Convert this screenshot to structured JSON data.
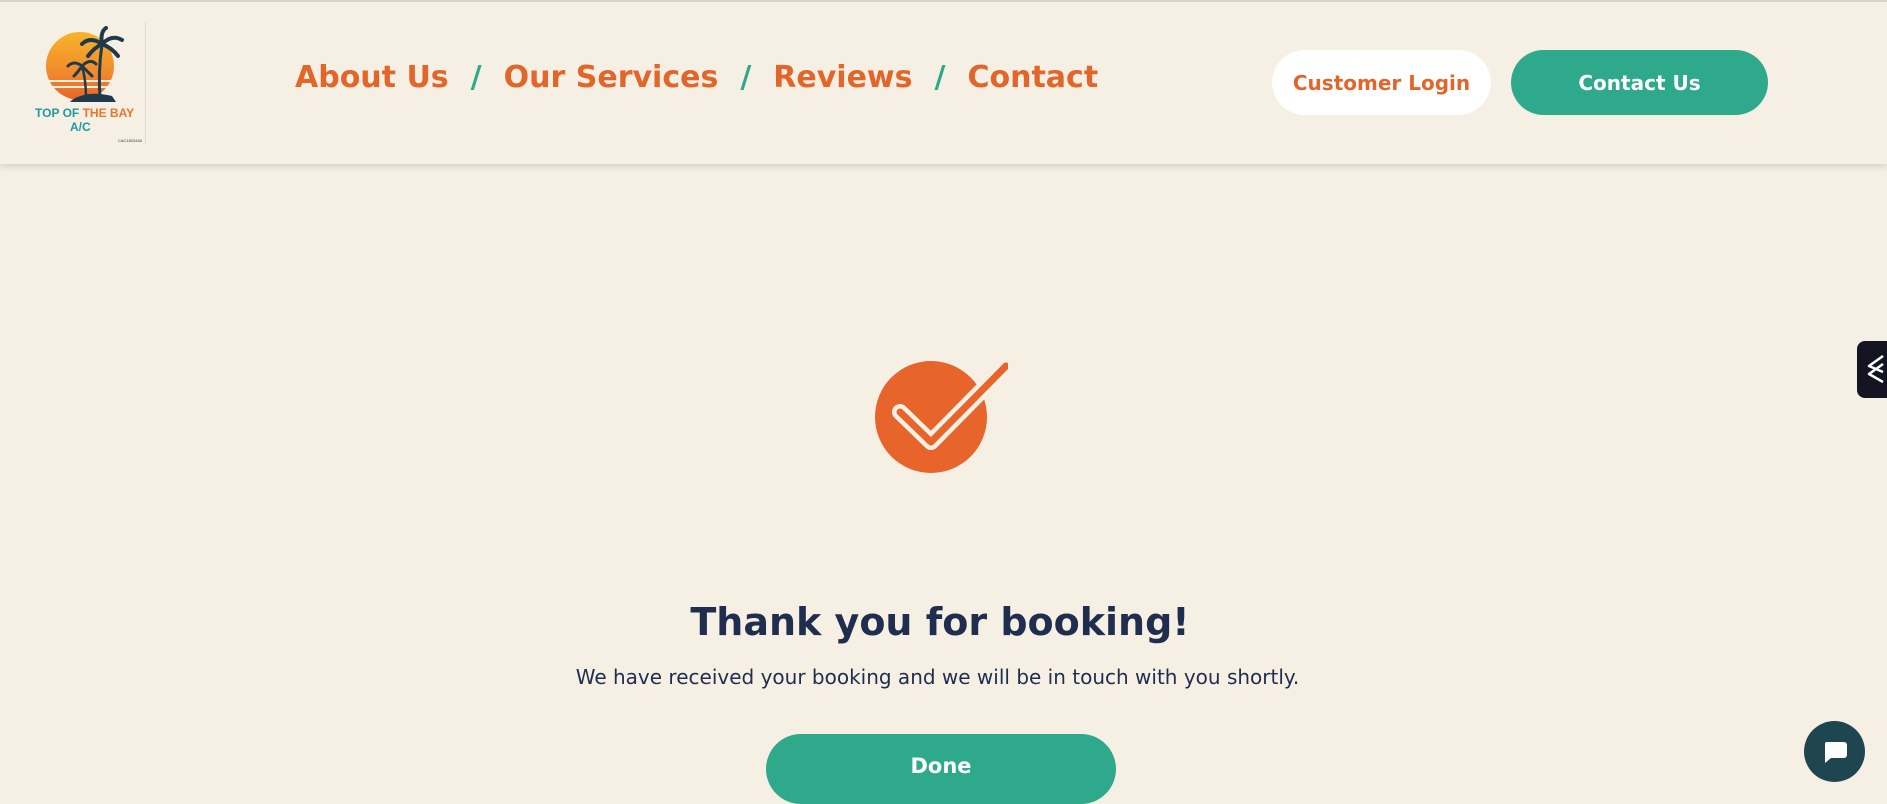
{
  "logo": {
    "line1_part1": "TOP OF ",
    "line1_part2": "THE BAY",
    "line2": "A/C",
    "small_text": "CAC1820434",
    "icon": "sunset-palm-logo"
  },
  "nav": {
    "items": [
      {
        "label": "About Us"
      },
      {
        "label": "Our Services"
      },
      {
        "label": "Reviews"
      },
      {
        "label": "Contact"
      }
    ],
    "separator": "/"
  },
  "header_buttons": {
    "customer_login": "Customer Login",
    "contact_us": "Contact Us"
  },
  "confirmation": {
    "icon": "checkmark-icon",
    "title": "Thank you for booking!",
    "message": "We have received your booking and we will be in touch with you shortly.",
    "done_label": "Done"
  },
  "widgets": {
    "side_tab_icon": "layers-icon",
    "chat_icon": "chat-icon"
  },
  "colors": {
    "background": "#f6efe4",
    "orange": "#e2652a",
    "teal": "#2ea98c",
    "navy": "#1f2d4f",
    "chat": "#1f4650"
  }
}
